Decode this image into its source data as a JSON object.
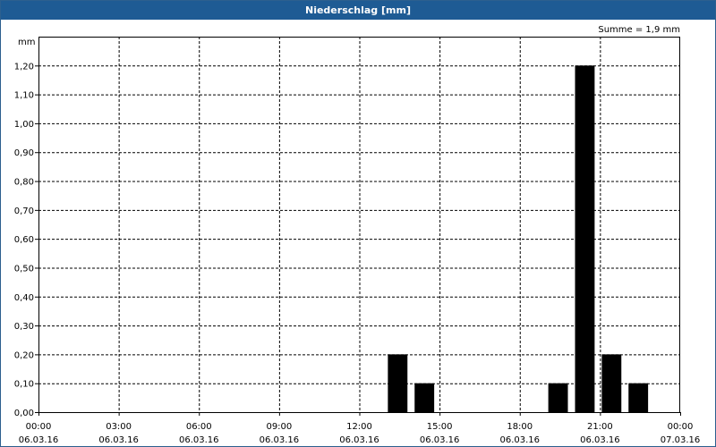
{
  "window": {
    "title": "Niederschlag [mm]"
  },
  "chart_data": {
    "type": "bar",
    "unit_label": "mm",
    "sum_label": "Summe = 1,9 mm",
    "ylim": [
      0,
      1.3
    ],
    "y_ticks": [
      {
        "value": 0.0,
        "label": "0,00"
      },
      {
        "value": 0.1,
        "label": "0,10"
      },
      {
        "value": 0.2,
        "label": "0,20"
      },
      {
        "value": 0.3,
        "label": "0,30"
      },
      {
        "value": 0.4,
        "label": "0,40"
      },
      {
        "value": 0.5,
        "label": "0,50"
      },
      {
        "value": 0.6,
        "label": "0,60"
      },
      {
        "value": 0.7,
        "label": "0,70"
      },
      {
        "value": 0.8,
        "label": "0,80"
      },
      {
        "value": 0.9,
        "label": "0,90"
      },
      {
        "value": 1.0,
        "label": "1,00"
      },
      {
        "value": 1.1,
        "label": "1,10"
      },
      {
        "value": 1.2,
        "label": "1,20"
      }
    ],
    "x_range": [
      "06.03.16 00:00",
      "07.03.16 00:00"
    ],
    "x_ticks": [
      {
        "time": "00:00",
        "date": "06.03.16"
      },
      {
        "time": "03:00",
        "date": "06.03.16"
      },
      {
        "time": "06:00",
        "date": "06.03.16"
      },
      {
        "time": "09:00",
        "date": "06.03.16"
      },
      {
        "time": "12:00",
        "date": "06.03.16"
      },
      {
        "time": "15:00",
        "date": "06.03.16"
      },
      {
        "time": "18:00",
        "date": "06.03.16"
      },
      {
        "time": "21:00",
        "date": "06.03.16"
      },
      {
        "time": "00:00",
        "date": "07.03.16"
      }
    ],
    "grid": true,
    "bars": [
      {
        "period": "06.03.16 13:00–14:00",
        "value": 0.2
      },
      {
        "period": "06.03.16 14:00–15:00",
        "value": 0.1
      },
      {
        "period": "06.03.16 19:00–20:00",
        "value": 0.1
      },
      {
        "period": "06.03.16 20:00–21:00",
        "value": 1.2
      },
      {
        "period": "06.03.16 21:00–22:00",
        "value": 0.2
      },
      {
        "period": "06.03.16 22:00–23:00",
        "value": 0.1
      }
    ],
    "bar_color": "#000000"
  }
}
